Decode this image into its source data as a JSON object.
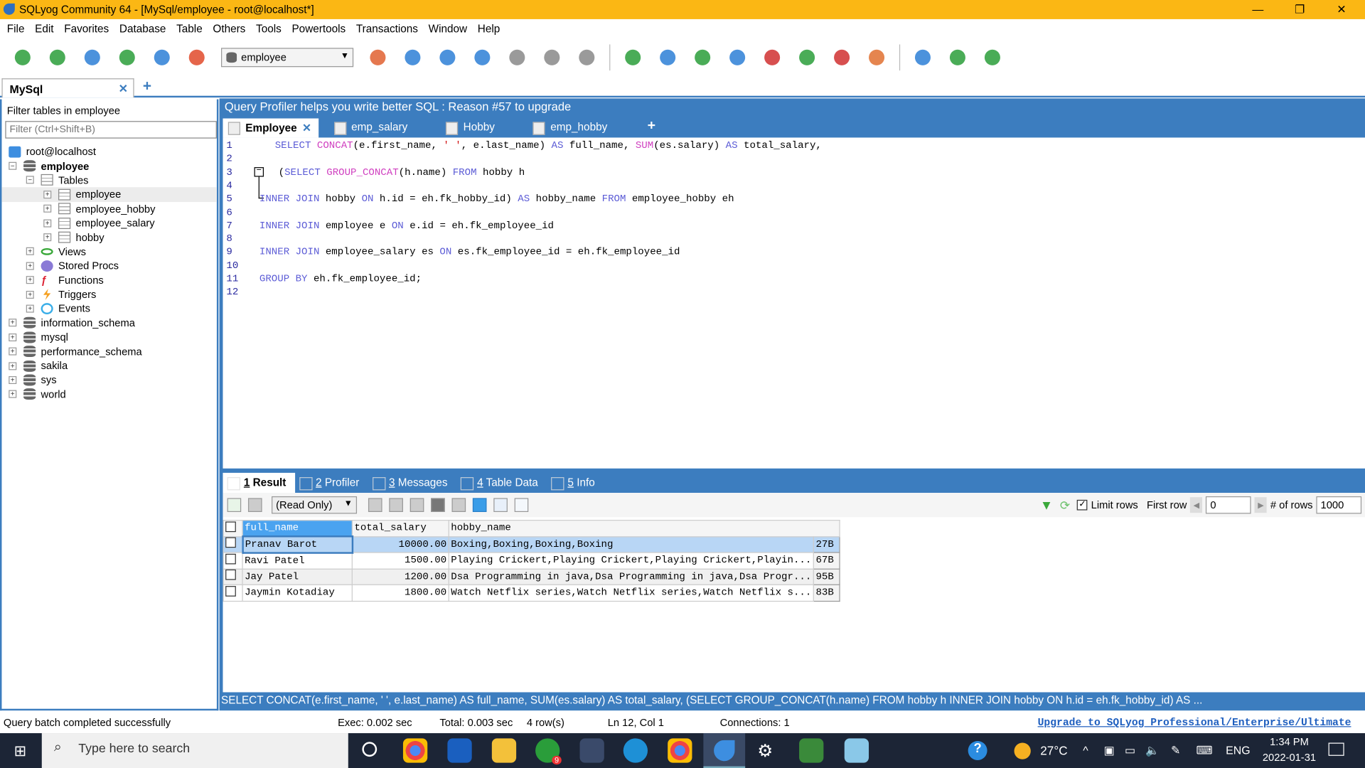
{
  "window": {
    "title": "SQLyog Community 64 - [MySql/employee - root@localhost*]",
    "minimize": "—",
    "restore": "❐",
    "close": "✕"
  },
  "menu": [
    "File",
    "Edit",
    "Favorites",
    "Database",
    "Table",
    "Others",
    "Tools",
    "Powertools",
    "Transactions",
    "Window",
    "Help"
  ],
  "toolbar": {
    "database_select": "employee"
  },
  "connection_tab": {
    "label": "MySql",
    "close": "✕",
    "add": "+"
  },
  "sidebar": {
    "filter_label": "Filter tables in employee",
    "filter_placeholder": "Filter (Ctrl+Shift+B)",
    "tree": [
      {
        "label": "root@localhost",
        "level": 0,
        "icon": "server-icon",
        "toggle": ""
      },
      {
        "label": "employee",
        "level": 0,
        "icon": "database-icon",
        "toggle": "−",
        "bold": true
      },
      {
        "label": "Tables",
        "level": 1,
        "icon": "tables-folder-icon",
        "toggle": "−"
      },
      {
        "label": "employee",
        "level": 2,
        "icon": "table-icon",
        "toggle": "+",
        "selected": true
      },
      {
        "label": "employee_hobby",
        "level": 2,
        "icon": "table-icon",
        "toggle": "+"
      },
      {
        "label": "employee_salary",
        "level": 2,
        "icon": "table-icon",
        "toggle": "+"
      },
      {
        "label": "hobby",
        "level": 2,
        "icon": "table-icon",
        "toggle": "+"
      },
      {
        "label": "Views",
        "level": 1,
        "icon": "views-icon",
        "toggle": "+"
      },
      {
        "label": "Stored Procs",
        "level": 1,
        "icon": "stored-procs-icon",
        "toggle": "+"
      },
      {
        "label": "Functions",
        "level": 1,
        "icon": "functions-icon",
        "toggle": "+"
      },
      {
        "label": "Triggers",
        "level": 1,
        "icon": "triggers-icon",
        "toggle": "+"
      },
      {
        "label": "Events",
        "level": 1,
        "icon": "events-icon",
        "toggle": "+"
      },
      {
        "label": "information_schema",
        "level": 0,
        "icon": "database-icon",
        "toggle": "+"
      },
      {
        "label": "mysql",
        "level": 0,
        "icon": "database-icon",
        "toggle": "+"
      },
      {
        "label": "performance_schema",
        "level": 0,
        "icon": "database-icon",
        "toggle": "+"
      },
      {
        "label": "sakila",
        "level": 0,
        "icon": "database-icon",
        "toggle": "+"
      },
      {
        "label": "sys",
        "level": 0,
        "icon": "database-icon",
        "toggle": "+"
      },
      {
        "label": "world",
        "level": 0,
        "icon": "database-icon",
        "toggle": "+"
      }
    ]
  },
  "banner": "Query Profiler helps you write better SQL : Reason #57 to upgrade",
  "query_tabs": [
    {
      "label": "Employee",
      "active": true,
      "close": "✕"
    },
    {
      "label": "emp_salary"
    },
    {
      "label": "Hobby"
    },
    {
      "label": "emp_hobby"
    }
  ],
  "query_tab_add": "+",
  "editor": {
    "fold_toggle": "−",
    "lines": [
      [
        [
          "  ",
          ""
        ],
        [
          "SELECT",
          "kw"
        ],
        [
          " ",
          ""
        ],
        [
          "CONCAT",
          "fn"
        ],
        [
          "(e.first_name, ",
          ""
        ],
        [
          "' '",
          "st"
        ],
        [
          ", e.last_name) ",
          ""
        ],
        [
          "AS",
          "kw"
        ],
        [
          " full_name, ",
          ""
        ],
        [
          "SUM",
          "fn"
        ],
        [
          "(es.salary) ",
          ""
        ],
        [
          "AS",
          "kw"
        ],
        [
          " total_salary,",
          ""
        ]
      ],
      [],
      [
        [
          "  (",
          ""
        ],
        [
          "SELECT",
          "kw"
        ],
        [
          " ",
          ""
        ],
        [
          "GROUP_CONCAT",
          "fn"
        ],
        [
          "(h.name) ",
          ""
        ],
        [
          "FROM",
          "kw"
        ],
        [
          " hobby h",
          ""
        ]
      ],
      [],
      [
        [
          "INNER JOIN",
          "kw"
        ],
        [
          " hobby ",
          ""
        ],
        [
          "ON",
          "kw"
        ],
        [
          " h.id = eh.fk_hobby_id) ",
          ""
        ],
        [
          "AS",
          "kw"
        ],
        [
          " hobby_name ",
          ""
        ],
        [
          "FROM",
          "kw"
        ],
        [
          " employee_hobby eh",
          ""
        ]
      ],
      [],
      [
        [
          "INNER JOIN",
          "kw"
        ],
        [
          " employee e ",
          ""
        ],
        [
          "ON",
          "kw"
        ],
        [
          " e.id = eh.fk_employee_id",
          ""
        ]
      ],
      [],
      [
        [
          "INNER JOIN",
          "kw"
        ],
        [
          " employee_salary es ",
          ""
        ],
        [
          "ON",
          "kw"
        ],
        [
          " es.fk_employee_id = eh.fk_employee_id",
          ""
        ]
      ],
      [],
      [
        [
          "GROUP BY",
          "kw"
        ],
        [
          " eh.fk_employee_id;",
          ""
        ]
      ],
      []
    ]
  },
  "result_tabs": [
    {
      "num": "1",
      "label": " Result",
      "active": true
    },
    {
      "num": "2",
      "label": " Profiler"
    },
    {
      "num": "3",
      "label": " Messages"
    },
    {
      "num": "4",
      "label": " Table Data"
    },
    {
      "num": "5",
      "label": " Info"
    }
  ],
  "result_toolbar": {
    "mode": "(Read Only)",
    "limit_rows_label": "Limit rows",
    "limit_rows_checked": true,
    "first_row_label": "First row",
    "first_row": "0",
    "num_rows_label": "# of rows",
    "num_rows": "1000"
  },
  "grid": {
    "columns": [
      "full_name",
      "total_salary",
      "hobby_name"
    ],
    "rows": [
      {
        "full_name": "Pranav Barot",
        "total_salary": "10000.00",
        "hobby_name": "Boxing,Boxing,Boxing,Boxing",
        "size": "27B"
      },
      {
        "full_name": "Ravi Patel",
        "total_salary": "1500.00",
        "hobby_name": "Playing Crickert,Playing Crickert,Playing Crickert,Playin...",
        "size": "67B"
      },
      {
        "full_name": "Jay Patel",
        "total_salary": "1200.00",
        "hobby_name": "Dsa Programming in java,Dsa Programming in java,Dsa Progr...",
        "size": "95B"
      },
      {
        "full_name": "Jaymin Kotadiay",
        "total_salary": "1800.00",
        "hobby_name": "Watch Netflix series,Watch Netflix series,Watch Netflix s...",
        "size": "83B"
      }
    ]
  },
  "sql_preview": "SELECT CONCAT(e.first_name, ' ', e.last_name) AS full_name, SUM(es.salary) AS total_salary, (SELECT GROUP_CONCAT(h.name) FROM hobby h INNER JOIN hobby ON h.id = eh.fk_hobby_id) AS ...",
  "status": {
    "message": "Query batch completed successfully",
    "exec": "Exec: 0.002 sec",
    "total": "Total: 0.003 sec",
    "rows": "4 row(s)",
    "position": "Ln 12, Col 1",
    "connections": "Connections: 1",
    "upgrade": "Upgrade to SQLyog Professional/Enterprise/Ultimate"
  },
  "taskbar": {
    "search_placeholder": "Type here to search",
    "weather": "27°C",
    "language": "ENG",
    "time": "1:34 PM",
    "date": "2022-01-31",
    "badge": "9"
  },
  "colors": {
    "accent": "#3c7dbf",
    "titlebar": "#fbb714",
    "taskbar": "#1c2536"
  }
}
